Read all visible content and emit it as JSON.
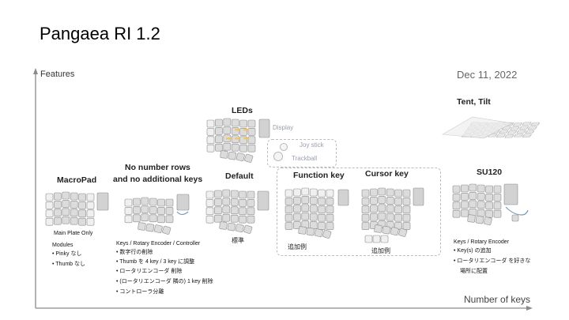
{
  "slide": {
    "title": "Pangaea RI 1.2",
    "date": "Dec 11, 2022",
    "axis_y_label": "Features",
    "axis_x_label": "Number of keys"
  },
  "variants": {
    "macropad": {
      "title": "MacroPad",
      "caption": "Main Plate Only",
      "modules_heading": "Modules",
      "modules": [
        "• Pinky なし",
        "• Thumb なし"
      ]
    },
    "no_number_rows": {
      "title_line1": "No number rows",
      "title_line2": "and no additional keys",
      "notes_heading": "Keys / Rotary Encoder / Controller",
      "notes": [
        "• 数字行の削除",
        "• Thumb を 4 key / 3 key に調整",
        "• ロータリエンコーダ 削除",
        "• (ロータリエンコーダ 隣の) 1 key 削除",
        "• コントローラ分離"
      ]
    },
    "leds": {
      "title": "LEDs",
      "display_label": "Display",
      "joystick_label": "Joy stick",
      "trackball_label": "Trackball"
    },
    "default": {
      "title": "Default",
      "caption": "標準"
    },
    "function_key": {
      "title": "Function key",
      "caption": "追加例"
    },
    "cursor_key": {
      "title": "Cursor key",
      "caption": "追加例"
    },
    "su120": {
      "title": "SU120",
      "notes_heading": "Keys / Rotary Encoder",
      "notes": [
        "• Key(s) の追加",
        "• ロータリエンコーダ を好きな",
        "場所に配置"
      ]
    },
    "tent_tilt": {
      "title": "Tent, Tilt"
    }
  },
  "colors": {
    "key_fill": "#dcdcdc",
    "key_fill_light": "#f0f0f0",
    "key_stroke": "#8c8c8c",
    "axis": "#8a8a8a",
    "led_accent": "#f2c24f",
    "gray_label": "#9aa0aa"
  }
}
